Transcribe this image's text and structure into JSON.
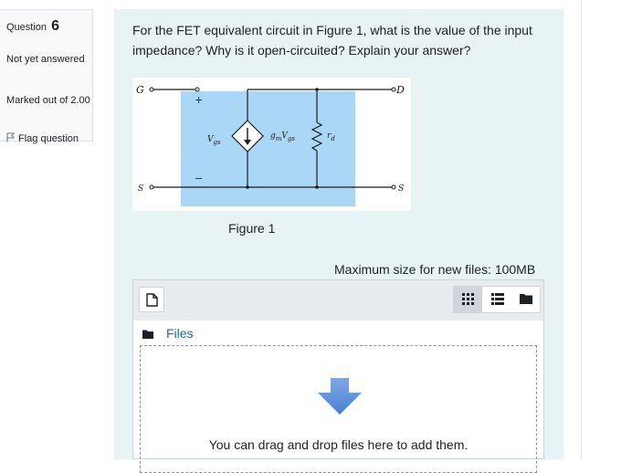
{
  "question_info": {
    "prefix": "Question",
    "number": "6",
    "state": "Not yet answered",
    "grade": "Marked out of 2.00",
    "flag_label": "Flag question"
  },
  "question": {
    "text": "For the FET equivalent circuit in Figure 1, what is the value of the input impedance? Why is it open-circuited? Explain your answer?",
    "figure": {
      "caption": "Figure 1",
      "labels": {
        "gate": "G",
        "drain": "D",
        "source_left": "S",
        "source_right": "S",
        "plus": "+",
        "minus": "−",
        "vgs": "V",
        "vgs_sub": "gs",
        "gm": "g",
        "gm_sub": "m",
        "gm_v": "V",
        "gm_v_sub": "gs",
        "rd": "r",
        "rd_sub": "d"
      },
      "colors": {
        "shade": "#aad7f5",
        "line": "#1a1a1a"
      }
    }
  },
  "upload": {
    "max_size_text": "Maximum size for new files: 100MB",
    "path_label": "Files",
    "drop_text": "You can drag and drop files here to add them.",
    "icons": [
      "add-file-icon",
      "grid-view-icon",
      "list-view-icon",
      "folder-view-icon",
      "folder-icon",
      "download-arrow-icon"
    ],
    "colors": {
      "arrow": "#5b8fd6",
      "link": "#0f6cbf"
    }
  }
}
